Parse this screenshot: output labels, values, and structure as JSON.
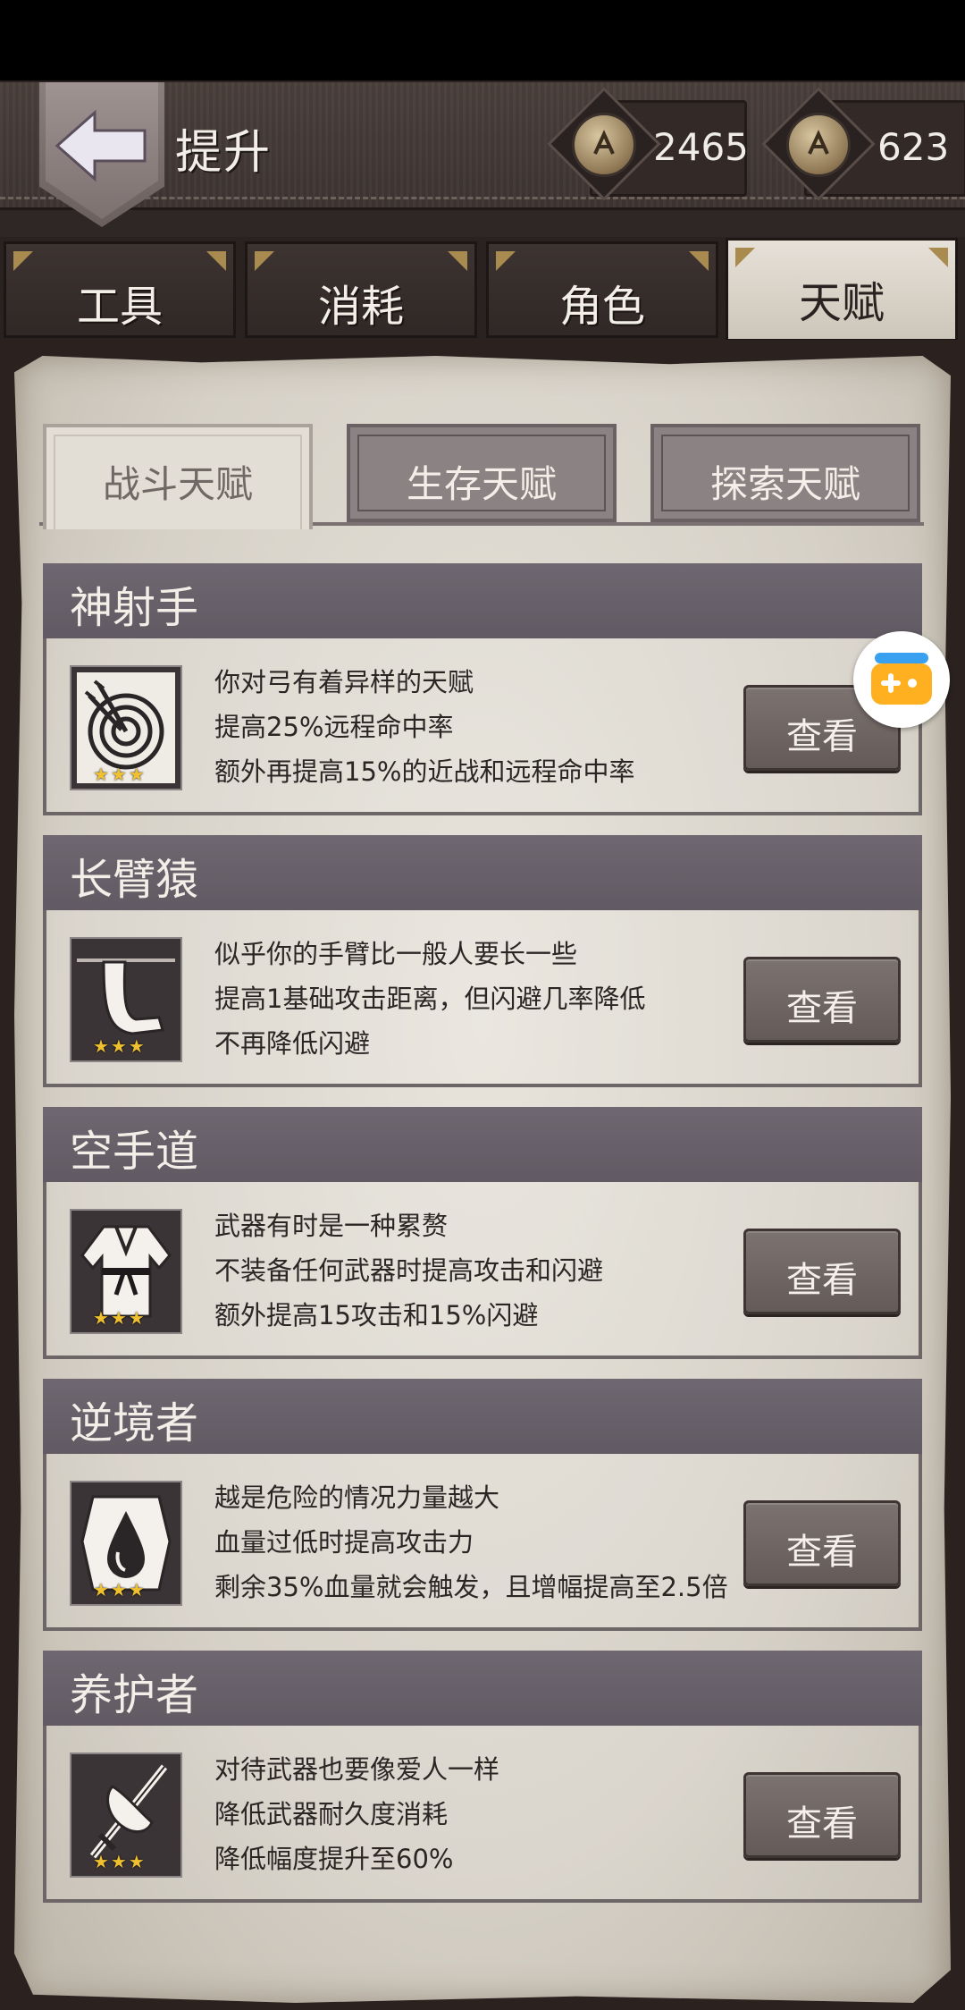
{
  "header": {
    "title": "提升",
    "currency": [
      {
        "icon": "coin-icon",
        "value": "2465"
      },
      {
        "icon": "coin-icon",
        "value": "623"
      }
    ]
  },
  "main_tabs": [
    {
      "label": "工具",
      "active": false
    },
    {
      "label": "消耗",
      "active": false
    },
    {
      "label": "角色",
      "active": false
    },
    {
      "label": "天赋",
      "active": true
    }
  ],
  "sub_tabs": [
    {
      "label": "战斗天赋",
      "active": true
    },
    {
      "label": "生存天赋",
      "active": false
    },
    {
      "label": "探索天赋",
      "active": false
    }
  ],
  "talents": [
    {
      "name": "神射手",
      "icon": "archery-target-icon",
      "stars": "★★★",
      "lines": [
        "你对弓有着异样的天赋",
        "提高25%远程命中率",
        "额外再提高15%的近战和远程命中率"
      ],
      "button": "查看"
    },
    {
      "name": "长臂猿",
      "icon": "long-arm-icon",
      "stars": "★★★",
      "lines": [
        "似乎你的手臂比一般人要长一些",
        "提高1基础攻击距离，但闪避几率降低",
        "不再降低闪避"
      ],
      "button": "查看"
    },
    {
      "name": "空手道",
      "icon": "karate-gi-icon",
      "stars": "★★★",
      "lines": [
        "武器有时是一种累赘",
        "不装备任何武器时提高攻击和闪避",
        "额外提高15攻击和15%闪避"
      ],
      "button": "查看"
    },
    {
      "name": "逆境者",
      "icon": "blood-drop-icon",
      "stars": "★★★",
      "lines": [
        "越是危险的情况力量越大",
        "血量过低时提高攻击力",
        "剩余35%血量就会触发，且增幅提高至2.5倍"
      ],
      "button": "查看"
    },
    {
      "name": "养护者",
      "icon": "sword-care-icon",
      "stars": "★★★",
      "lines": [
        "对待武器也要像爱人一样",
        "降低武器耐久度消耗",
        "降低幅度提升至60%"
      ],
      "button": "查看"
    }
  ]
}
